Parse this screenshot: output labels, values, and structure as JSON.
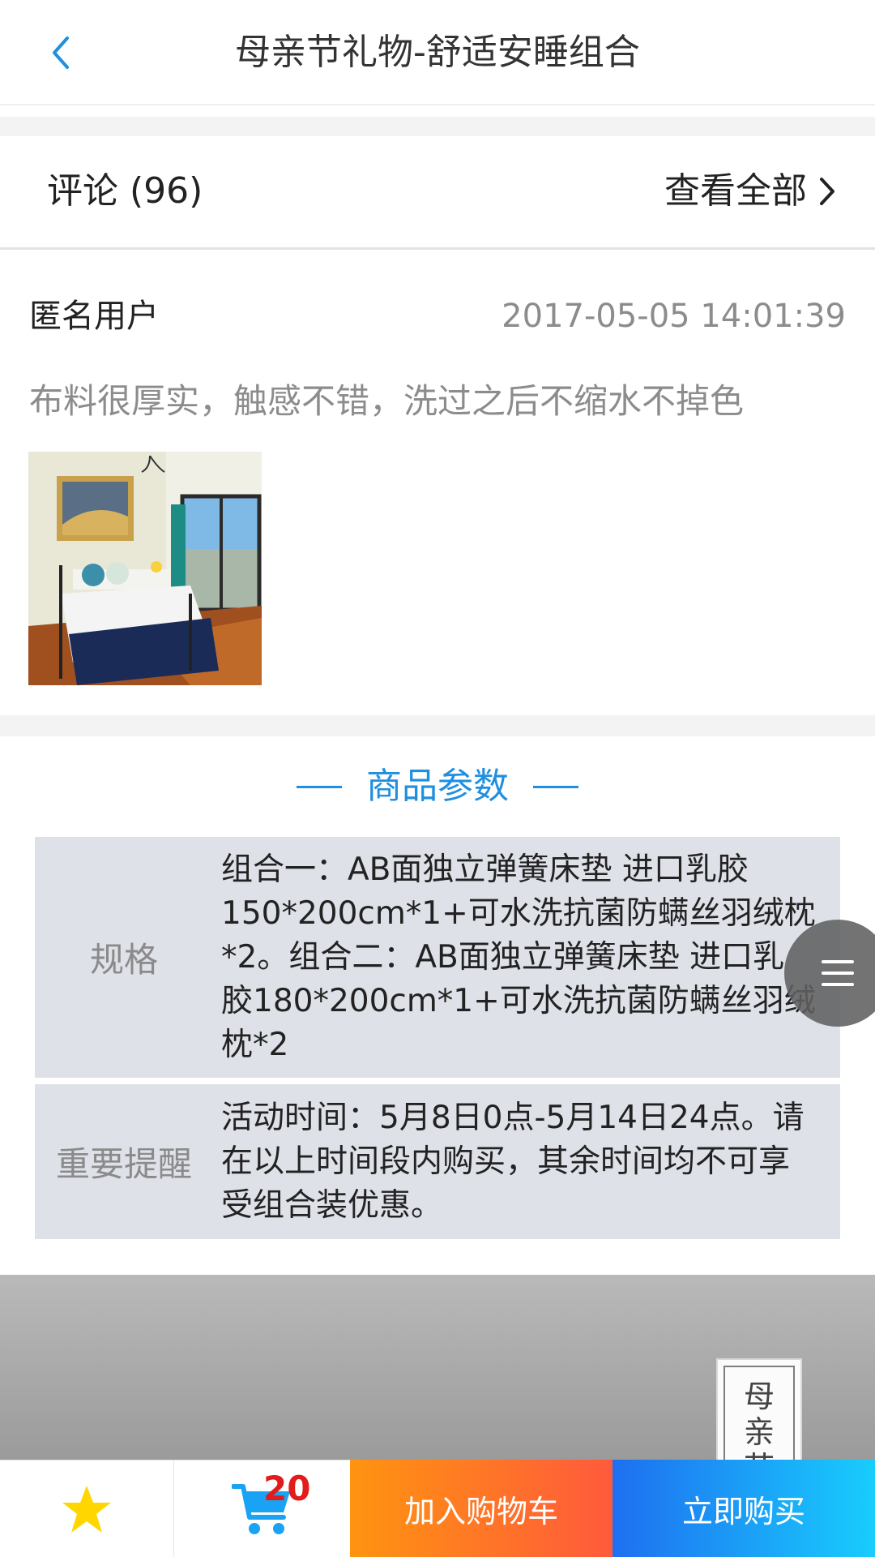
{
  "header": {
    "title": "母亲节礼物-舒适安睡组合",
    "back_icon": "chevron-left-icon"
  },
  "comments": {
    "title": "评论 (96)",
    "view_all": "查看全部",
    "review": {
      "user": "匿名用户",
      "time": "2017-05-05 14:01:39",
      "text": "布料很厚实，触感不错，洗过之后不缩水不掉色",
      "photo": "bedroom-photo"
    }
  },
  "params": {
    "title": "商品参数",
    "rows": [
      {
        "label": "规格",
        "value": "组合一：AB面独立弹簧床垫 进口乳胶150*200cm*1+可水洗抗菌防螨丝羽绒枕*2。组合二：AB面独立弹簧床垫 进口乳胶180*200cm*1+可水洗抗菌防螨丝羽绒枕*2"
      },
      {
        "label": "重要提醒",
        "value": "活动时间：5月8日0点-5月14日24点。请在以上时间段内购买，其余时间均不可享受组合装优惠。"
      }
    ]
  },
  "banner": {
    "tag_chars": [
      "母",
      "亲",
      "节"
    ]
  },
  "bottom_bar": {
    "cart_count": "20",
    "add_to_cart": "加入购物车",
    "buy_now": "立即购买"
  },
  "colors": {
    "accent_blue": "#1f8fe0",
    "star": "#ffd600",
    "cart_icon": "#1aa3f5",
    "badge": "#e21b1b",
    "orange_start": "#ff9410",
    "orange_end": "#ff5a3c",
    "blue_start": "#1e6ff0",
    "blue_end": "#18cdfd"
  }
}
